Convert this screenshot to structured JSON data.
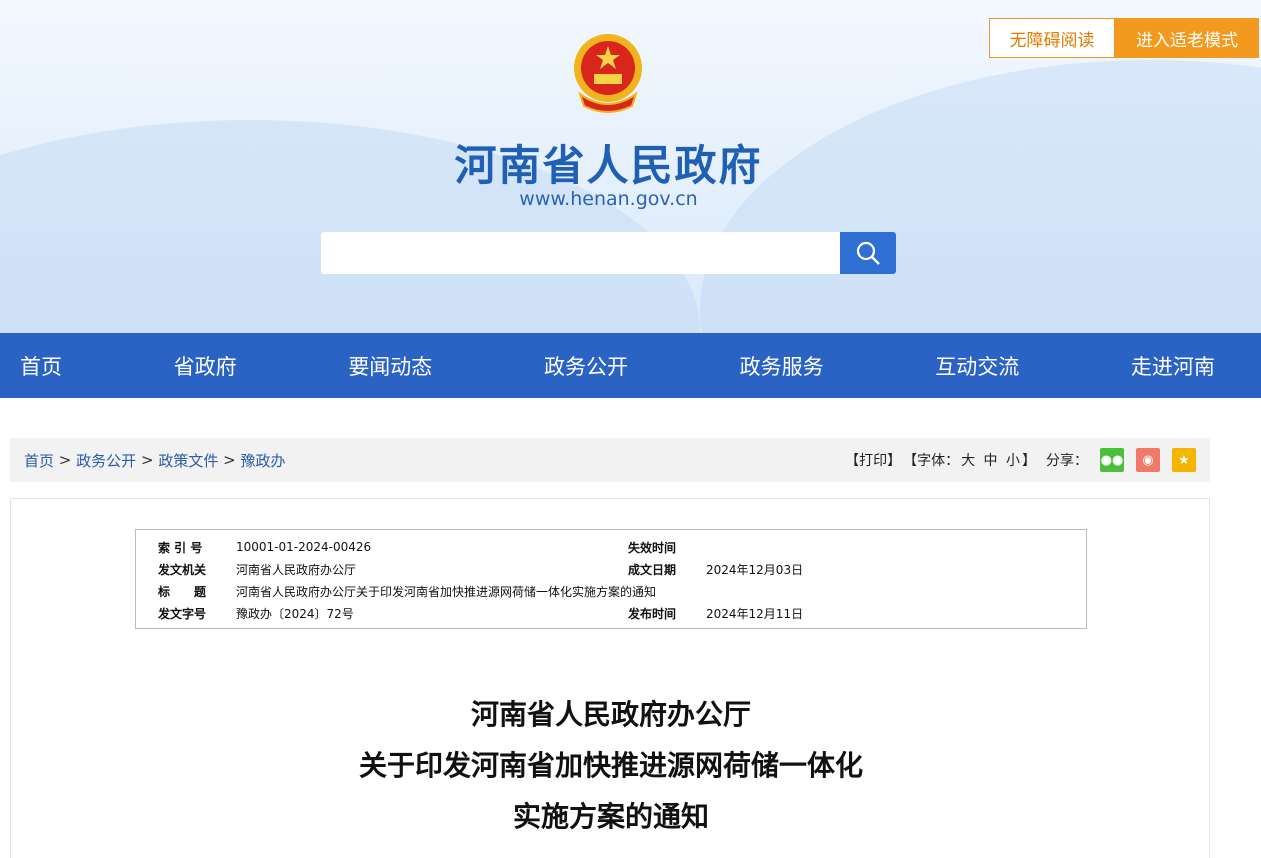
{
  "header": {
    "title": "河南省人民政府",
    "url": "www.henan.gov.cn",
    "search_placeholder": "",
    "accessibility_btn": "无障碍阅读",
    "elder_btn": "进入适老模式"
  },
  "nav": [
    "首页",
    "省政府",
    "要闻动态",
    "政务公开",
    "政务服务",
    "互动交流",
    "走进河南"
  ],
  "breadcrumb": [
    "首页",
    "政务公开",
    "政策文件",
    "豫政办"
  ],
  "breadcrumb_sep": ">",
  "tools": {
    "print": "【打印】",
    "font_label": "【字体：",
    "font_large": "大",
    "font_mid": "中",
    "font_small": "小",
    "font_end": "】",
    "share": "分享："
  },
  "colors": {
    "nav": "#2a63c3",
    "wechat": "#4cbf3a",
    "weibo": "#f07a68",
    "qzone": "#f5b400"
  },
  "meta": {
    "index_label": "索 引 号",
    "index": "10001-01-2024-00426",
    "expire_label": "失效时间",
    "expire": "",
    "issuer_label": "发文机关",
    "issuer": "河南省人民政府办公厅",
    "date_label": "成文日期",
    "date": "2024年12月03日",
    "title_label": "标　　题",
    "title": "河南省人民政府办公厅关于印发河南省加快推进源网荷储一体化实施方案的通知",
    "docno_label": "发文字号",
    "docno": "豫政办〔2024〕72号",
    "publish_label": "发布时间",
    "publish": "2024年12月11日"
  },
  "doc_title": [
    "河南省人民政府办公厅",
    "关于印发河南省加快推进源网荷储一体化",
    "实施方案的通知"
  ]
}
